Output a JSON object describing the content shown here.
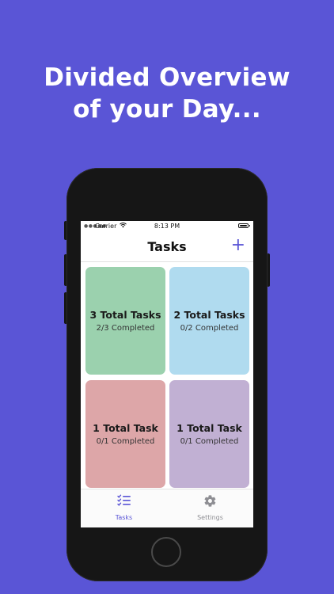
{
  "headline": {
    "line1": "Divided Overview",
    "line2": "of your Day..."
  },
  "statusbar": {
    "carrier": "Carrier",
    "time": "8:13 PM"
  },
  "navbar": {
    "title": "Tasks",
    "add_label": "+"
  },
  "cards": [
    {
      "title": "3 Total Tasks",
      "subtitle": "2/3 Completed",
      "color": "#9bd1ae"
    },
    {
      "title": "2 Total Tasks",
      "subtitle": "0/2 Completed",
      "color": "#b0dbef"
    },
    {
      "title": "1 Total Task",
      "subtitle": "0/1 Completed",
      "color": "#dda6a8"
    },
    {
      "title": "1 Total Task",
      "subtitle": "0/1 Completed",
      "color": "#c1b0d3"
    }
  ],
  "tabs": [
    {
      "label": "Tasks",
      "icon": "checklist-icon",
      "active": true
    },
    {
      "label": "Settings",
      "icon": "gear-icon",
      "active": false
    }
  ],
  "colors": {
    "accent": "#5a55d6",
    "background": "#5a55d6",
    "inactive_tab": "#8e8e93"
  }
}
